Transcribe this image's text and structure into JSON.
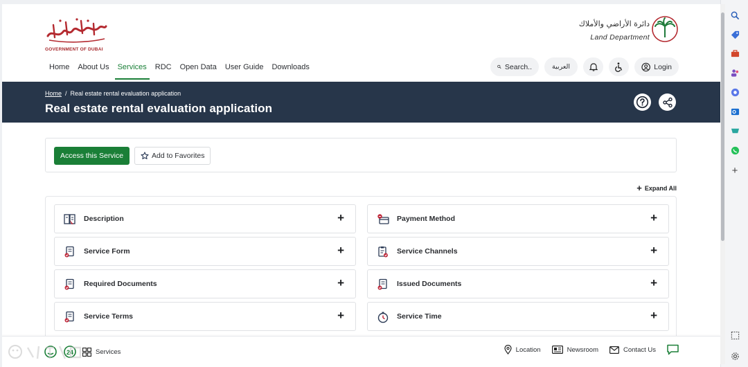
{
  "header": {
    "gov_logo_text": "GOVERNMENT OF DUBAI",
    "dld_arabic": "دائرة الأراضي والأملاك",
    "dld_english": "Land Department"
  },
  "nav": {
    "items": [
      {
        "label": "Home",
        "active": false
      },
      {
        "label": "About Us",
        "active": false
      },
      {
        "label": "Services",
        "active": true
      },
      {
        "label": "RDC",
        "active": false
      },
      {
        "label": "Open Data",
        "active": false
      },
      {
        "label": "User Guide",
        "active": false
      },
      {
        "label": "Downloads",
        "active": false
      }
    ]
  },
  "tools": {
    "search_label": "Search..",
    "lang_label": "العربية",
    "login_label": "Login"
  },
  "banner": {
    "crumb_home": "Home",
    "crumb_sep": "/",
    "crumb_current": "Real estate rental evaluation application",
    "title": "Real estate rental evaluation application"
  },
  "actions": {
    "access_label": "Access this Service",
    "favorites_label": "Add to Favorites"
  },
  "expand_all_label": "Expand All",
  "accordion": {
    "left": [
      {
        "label": "Description",
        "icon": "description-icon"
      },
      {
        "label": "Service Form",
        "icon": "service-form-icon"
      },
      {
        "label": "Required Documents",
        "icon": "required-documents-icon"
      },
      {
        "label": "Service Terms",
        "icon": "service-terms-icon"
      }
    ],
    "right": [
      {
        "label": "Payment Method",
        "icon": "payment-method-icon"
      },
      {
        "label": "Service Channels",
        "icon": "service-channels-icon"
      },
      {
        "label": "Issued Documents",
        "icon": "issued-documents-icon"
      },
      {
        "label": "Service Time",
        "icon": "service-time-icon"
      }
    ]
  },
  "bottom_bar": {
    "services_label": "Services",
    "location_label": "Location",
    "newsroom_label": "Newsroom",
    "contact_label": "Contact Us"
  },
  "colors": {
    "accent_green": "#1a7f37",
    "banner_navy": "#27364a",
    "icon_red": "#c0283a",
    "icon_navy": "#2b3a55"
  }
}
